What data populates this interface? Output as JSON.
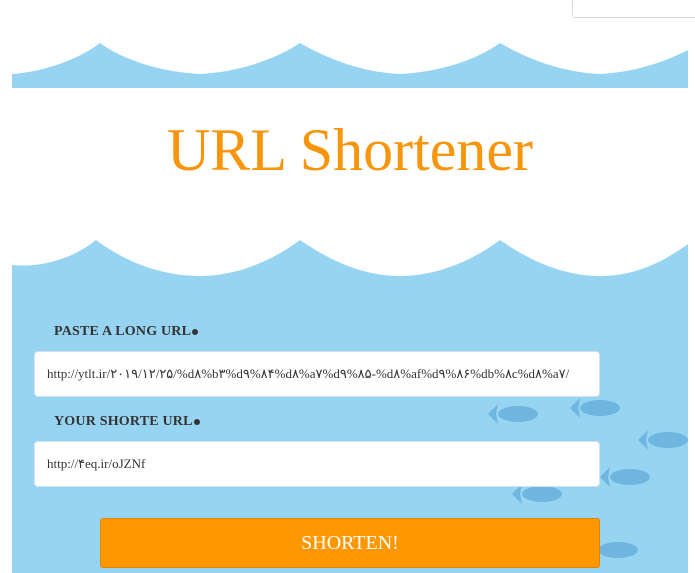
{
  "language_selector": {
    "value": ""
  },
  "title": "URL Shortener",
  "form": {
    "long_url_label": "PASTE A LONG URL",
    "long_url_value": "http://ytlt.ir/۲۰۱۹/۱۲/۲۵/%d۸%b۳%d۹%۸۴%d۸%a۷%d۹%۸۵-%d۸%af%d۹%۸۶%db%۸c%d۸%a۷/",
    "short_url_label": "YOUR SHORTE URL",
    "short_url_value": "http://۴eq.ir/oJZNf",
    "submit_label": "SHORTEN!"
  },
  "colors": {
    "water": "#97d4f2",
    "accent": "#f7960c",
    "button": "#ff9800",
    "fish": "#6eb6df"
  },
  "icons": [
    "fish-icon"
  ]
}
